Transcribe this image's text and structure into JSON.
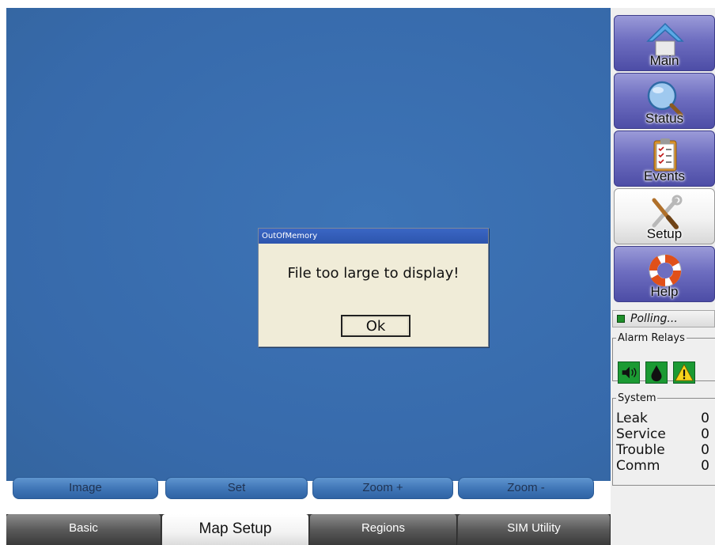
{
  "dialog": {
    "title": "OutOfMemory",
    "message": "File too large to display!",
    "ok_label": "Ok"
  },
  "toolbar": {
    "buttons": [
      {
        "label": "Image"
      },
      {
        "label": "Set"
      },
      {
        "label": "Zoom +"
      },
      {
        "label": "Zoom -"
      }
    ]
  },
  "tabs": {
    "items": [
      {
        "label": "Basic",
        "active": false
      },
      {
        "label": "Map Setup",
        "active": true
      },
      {
        "label": "Regions",
        "active": false
      },
      {
        "label": "SIM Utility",
        "active": false
      }
    ]
  },
  "sidebar": {
    "nav": [
      {
        "label": "Main",
        "icon": "home-icon",
        "active": false
      },
      {
        "label": "Status",
        "icon": "magnifier-icon",
        "active": false
      },
      {
        "label": "Events",
        "icon": "clipboard-icon",
        "active": false
      },
      {
        "label": "Setup",
        "icon": "tools-icon",
        "active": true
      },
      {
        "label": "Help",
        "icon": "lifebuoy-icon",
        "active": false
      }
    ],
    "polling_text": "Polling...",
    "alarm_relays": {
      "title": "Alarm Relays",
      "icons": [
        "speaker-icon",
        "drop-icon",
        "warning-icon"
      ]
    },
    "system": {
      "title": "System",
      "rows": [
        {
          "label": "Leak",
          "value": "0"
        },
        {
          "label": "Service",
          "value": "0"
        },
        {
          "label": "Trouble",
          "value": "0"
        },
        {
          "label": "Comm",
          "value": "0"
        }
      ]
    }
  },
  "colors": {
    "canvas": "#3a6eb0",
    "dialog_bg": "#f0ecd8",
    "nav_button": "#6e6ec0",
    "relay_green": "#1b9a33"
  }
}
